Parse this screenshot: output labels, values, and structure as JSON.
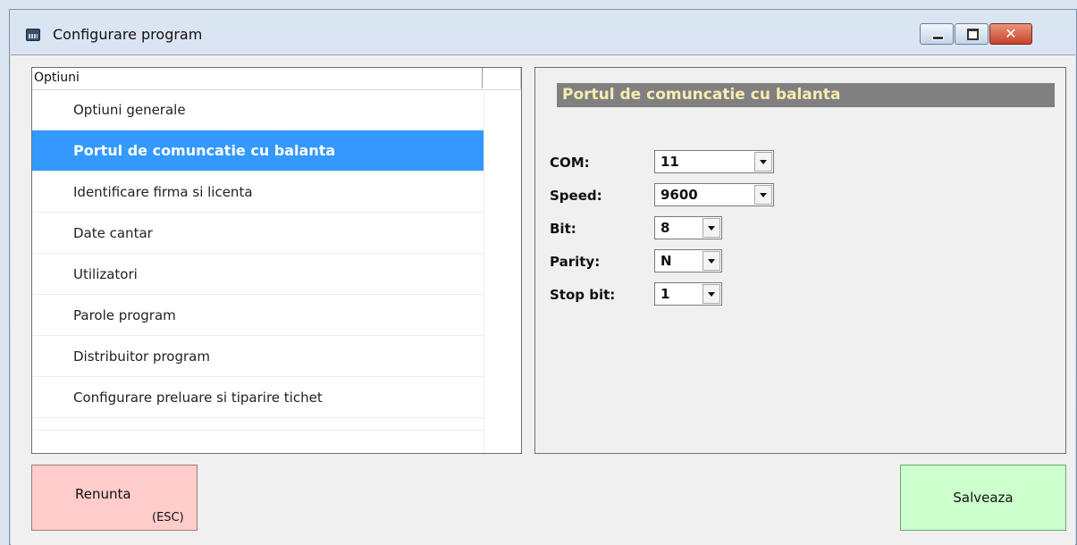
{
  "window": {
    "title": "Configurare program",
    "close_glyph": "✕"
  },
  "list": {
    "header": "Optiuni",
    "items": [
      "Optiuni generale",
      "Portul de comuncatie cu balanta",
      "Identificare firma si licenta",
      "Date cantar",
      "Utilizatori",
      "Parole program",
      "Distribuitor program",
      "Configurare preluare si tiparire tichet"
    ],
    "selected_index": 1
  },
  "panel": {
    "title": "Portul de comuncatie cu balanta",
    "fields": [
      {
        "label": "COM:",
        "value": "11"
      },
      {
        "label": "Speed:",
        "value": "9600"
      },
      {
        "label": "Bit:",
        "value": "8"
      },
      {
        "label": "Parity:",
        "value": "N"
      },
      {
        "label": "Stop bit:",
        "value": "1"
      }
    ]
  },
  "buttons": {
    "cancel_label": "Renunta",
    "cancel_hint": "(ESC)",
    "save_label": "Salveaza"
  },
  "colors": {
    "selection": "#3399ff",
    "panel_title_bg": "#808080",
    "panel_title_text": "#f7ecb0",
    "cancel_bg": "#ffcccc",
    "save_bg": "#ccffcc"
  }
}
